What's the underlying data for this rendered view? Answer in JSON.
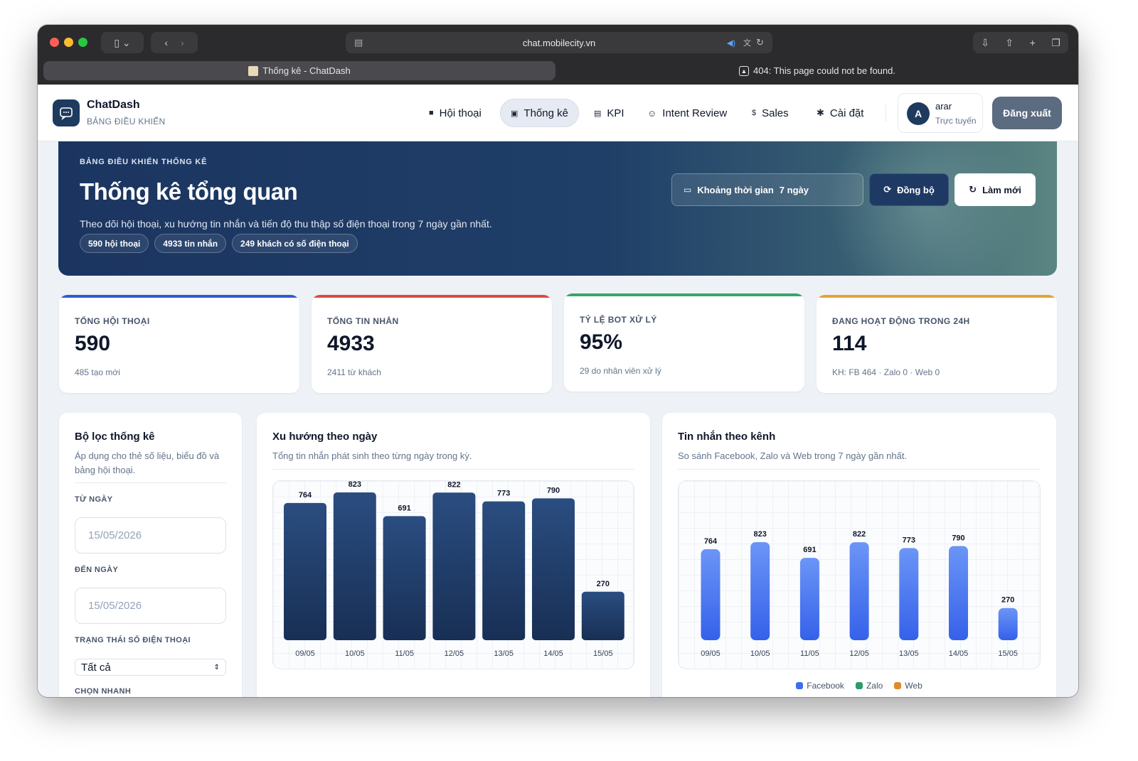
{
  "browser": {
    "url": "chat.mobilecity.vn",
    "tab_active": "Thống kê - ChatDash",
    "tab_other": "404: This page could not be found."
  },
  "app": {
    "brand": "ChatDash",
    "brand_sub": "BẢNG ĐIỀU KHIỂN",
    "nav": [
      {
        "label": "Hội thoại",
        "icon": "chat-icon"
      },
      {
        "label": "Thống kê",
        "icon": "stats-icon"
      },
      {
        "label": "KPI",
        "icon": "kpi-icon"
      },
      {
        "label": "Intent Review",
        "icon": "smile-icon"
      },
      {
        "label": "Sales",
        "icon": "dollar-icon"
      },
      {
        "label": "Cài đặt",
        "icon": "gear-icon"
      }
    ],
    "user": {
      "initial": "A",
      "name": "arar",
      "status": "Trực tuyến"
    },
    "logout_label": "Đăng xuất"
  },
  "hero": {
    "kicker": "BẢNG ĐIỀU KHIỂN THỐNG KÊ",
    "title": "Thống kê tổng quan",
    "description": "Theo dõi hội thoại, xu hướng tin nhắn và tiến độ thu thập số điện thoại trong 7 ngày gần nhất.",
    "chips": [
      "590 hội thoại",
      "4933 tin nhắn",
      "249 khách có số điện thoại"
    ],
    "range_label": "Khoảng thời gian",
    "range_value": "7 ngày",
    "sync_label": "Đồng bộ",
    "refresh_label": "Làm mới"
  },
  "stats": [
    {
      "label": "TỔNG HỘI THOẠI",
      "value": "590",
      "sub": "485 tạo mới",
      "color": "#2f5bd3"
    },
    {
      "label": "TỔNG TIN NHẮN",
      "value": "4933",
      "sub": "2411 từ khách",
      "color": "#d94b45"
    },
    {
      "label": "TỶ LỆ BOT XỬ LÝ",
      "value": "95%",
      "sub": "29 do nhân viên xử lý",
      "color": "#3aa46b"
    },
    {
      "label": "ĐANG HOẠT ĐỘNG TRONG 24H",
      "value": "114",
      "sub": "KH: FB 464 · Zalo 0 · Web 0",
      "color": "#e3a336"
    }
  ],
  "filter": {
    "title": "Bộ lọc thống kê",
    "subtitle": "Áp dụng cho thẻ số liệu, biểu đồ và bảng hội thoại.",
    "from_label": "TỪ NGÀY",
    "from_value": "15/05/2026",
    "to_label": "ĐẾN NGÀY",
    "to_value": "15/05/2026",
    "status_label": "TRẠNG THÁI SỐ ĐIỆN THOẠI",
    "status_value": "Tất cả",
    "quick_label": "CHỌN NHANH"
  },
  "trend": {
    "title": "Xu hướng theo ngày",
    "subtitle": "Tổng tin nhắn phát sinh theo từng ngày trong kỳ."
  },
  "channel": {
    "title": "Tin nhắn theo kênh",
    "subtitle": "So sánh Facebook, Zalo và Web trong 7 ngày gần nhất."
  },
  "chart_data": [
    {
      "type": "bar",
      "title": "Xu hướng theo ngày",
      "categories": [
        "09/05",
        "10/05",
        "11/05",
        "12/05",
        "13/05",
        "14/05",
        "15/05"
      ],
      "values": [
        764,
        823,
        691,
        822,
        773,
        790,
        270
      ],
      "color": "#1e3a64"
    },
    {
      "type": "bar",
      "title": "Tin nhắn theo kênh",
      "categories": [
        "09/05",
        "10/05",
        "11/05",
        "12/05",
        "13/05",
        "14/05",
        "15/05"
      ],
      "series": [
        {
          "name": "Facebook",
          "values": [
            764,
            823,
            691,
            822,
            773,
            790,
            270
          ],
          "color": "#3b6ff0"
        },
        {
          "name": "Zalo",
          "values": [
            0,
            0,
            0,
            0,
            0,
            0,
            0
          ],
          "color": "#2f9a6a"
        },
        {
          "name": "Web",
          "values": [
            0,
            0,
            0,
            0,
            0,
            0,
            0
          ],
          "color": "#e08a2e"
        }
      ]
    }
  ]
}
